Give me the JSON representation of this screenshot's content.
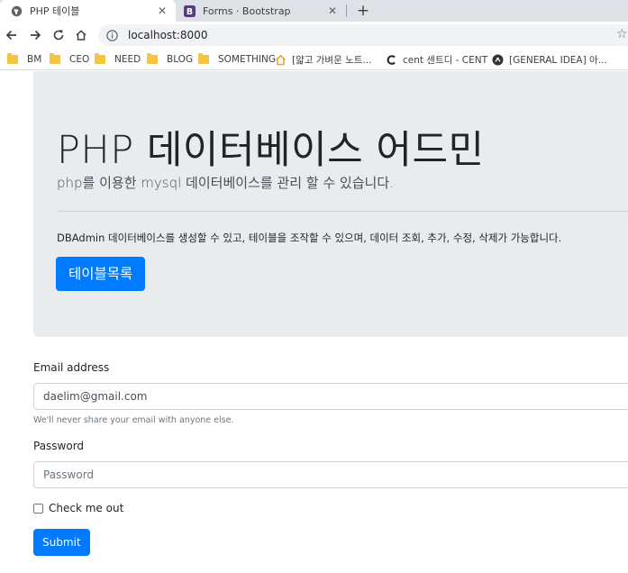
{
  "browser": {
    "tabs": [
      {
        "title": "PHP 테이블",
        "favicon": "globe-icon",
        "active": true
      },
      {
        "title": "Forms · Bootstrap",
        "favicon": "bootstrap-icon",
        "active": false
      }
    ],
    "address": "localhost:8000",
    "bookmarks": [
      {
        "label": "BM",
        "icon": "folder-icon"
      },
      {
        "label": "CEO",
        "icon": "folder-icon"
      },
      {
        "label": "NEED",
        "icon": "folder-icon"
      },
      {
        "label": "BLOG",
        "icon": "folder-icon"
      },
      {
        "label": "SOMETHING",
        "icon": "folder-icon"
      },
      {
        "label": "[얇고 가벼운 노트...",
        "icon": "home-icon"
      },
      {
        "label": "cent 센트디 - CENT",
        "icon": "cent-icon"
      },
      {
        "label": "[GENERAL IDEA] 아...",
        "icon": "general-idea-icon"
      }
    ]
  },
  "jumbotron": {
    "title": "PHP 데이터베이스 어드민",
    "lead": "php를 이용한 mysql 데이터베이스를 관리 할 수 있습니다.",
    "description": "DBAdmin 데이터베이스를 생성할 수 있고, 테이블을 조작할 수 있으며, 데이터 조회, 추가, 수정, 삭제가 가능합니다.",
    "button": "테이블목록"
  },
  "form": {
    "email_label": "Email address",
    "email_value": "daelim@gmail.com",
    "email_help": "We'll never share your email with anyone else.",
    "password_label": "Password",
    "password_placeholder": "Password",
    "check_label": "Check me out",
    "submit": "Submit"
  },
  "colors": {
    "primary": "#007bff",
    "jumbotron_bg": "#e9ecef",
    "tabbar_bg": "#dee1e6"
  }
}
